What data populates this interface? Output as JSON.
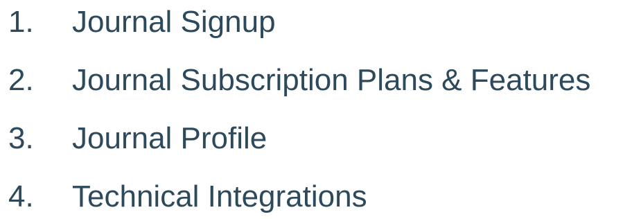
{
  "list": {
    "color": "#2d4a5c",
    "items": [
      {
        "number": "1.",
        "label": "Journal Signup"
      },
      {
        "number": "2.",
        "label": "Journal Subscription Plans & Features"
      },
      {
        "number": "3.",
        "label": "Journal Profile"
      },
      {
        "number": "4.",
        "label": "Technical Integrations"
      }
    ]
  }
}
